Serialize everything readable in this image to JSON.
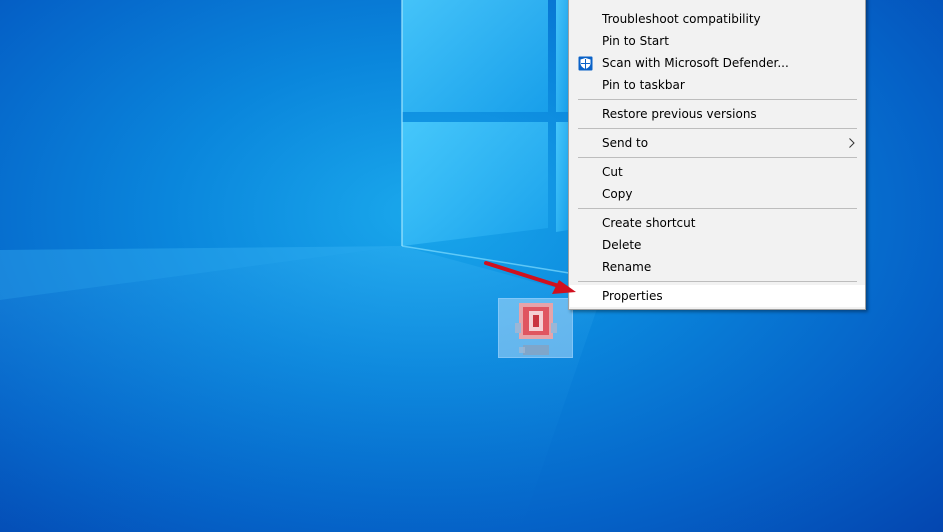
{
  "context_menu": {
    "items": [
      {
        "label": "Troubleshoot compatibility"
      },
      {
        "label": "Pin to Start"
      },
      {
        "label": "Scan with Microsoft Defender...",
        "icon": "defender-shield-icon"
      },
      {
        "label": "Pin to taskbar"
      },
      {
        "label": "Restore previous versions"
      },
      {
        "label": "Send to",
        "icon": "chevron-right-icon"
      },
      {
        "label": "Cut"
      },
      {
        "label": "Copy"
      },
      {
        "label": "Create shortcut"
      },
      {
        "label": "Delete"
      },
      {
        "label": "Rename"
      },
      {
        "label": "Properties",
        "highlighted": true
      }
    ]
  },
  "annotation": {
    "arrow_color": "#d0101e"
  },
  "colors": {
    "menu_bg": "#f2f2f2",
    "highlight_bg": "#ffffff",
    "defender_blue": "#0a62c8"
  }
}
